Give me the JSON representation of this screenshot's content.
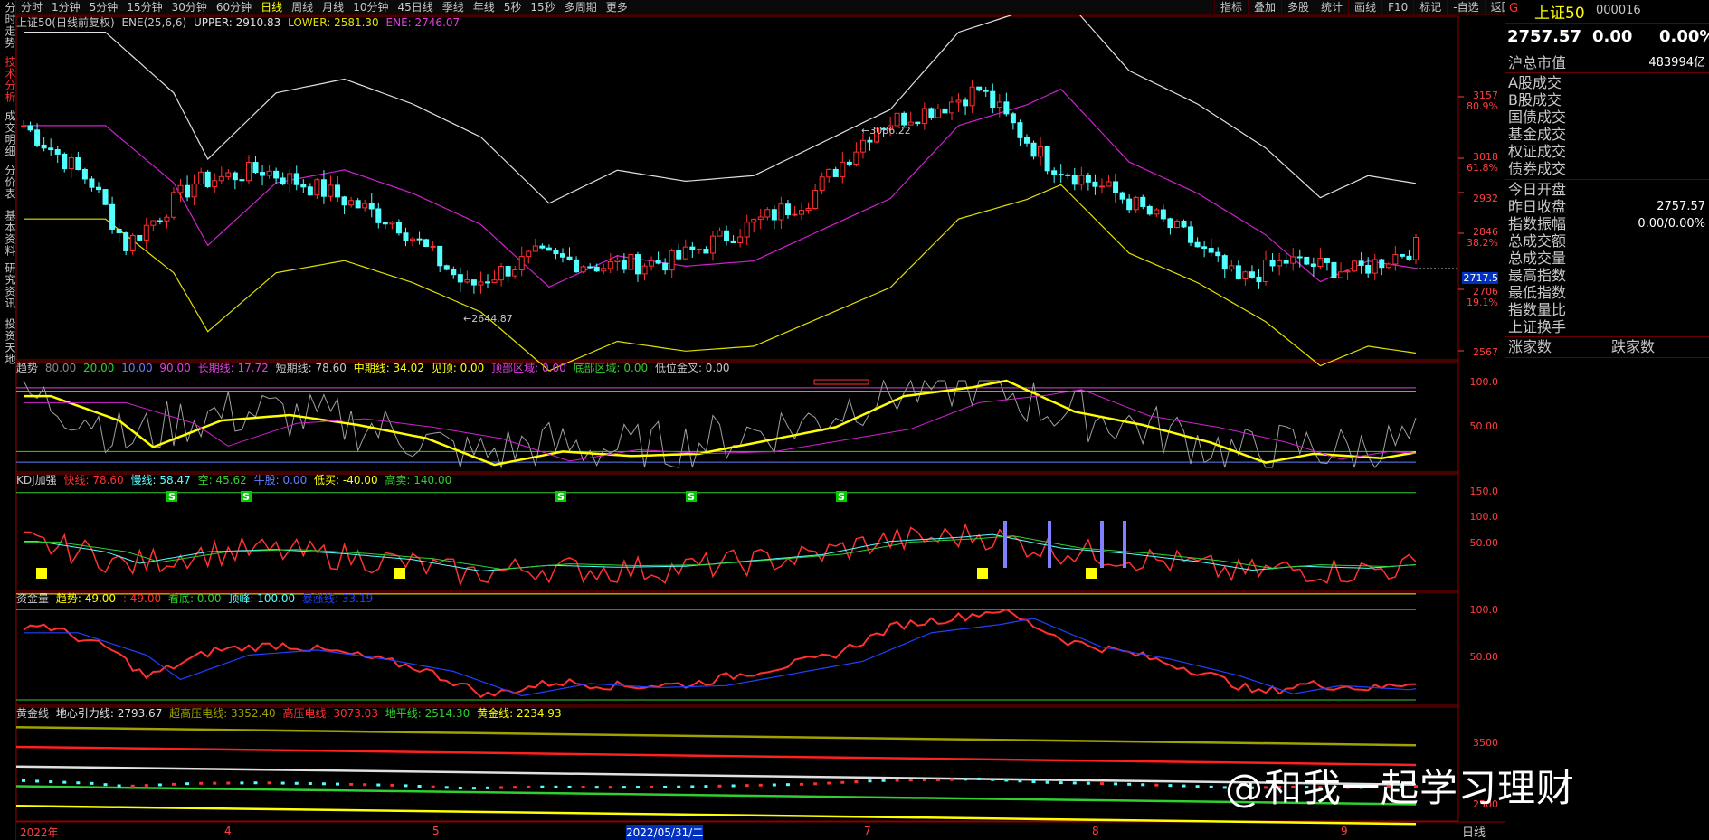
{
  "side_tabs": [
    "分时走势",
    "技术分析",
    "成交明细",
    "分价表",
    "基本资料",
    "研究资讯",
    "投资天地"
  ],
  "timeframes": [
    "分时",
    "1分钟",
    "5分钟",
    "15分钟",
    "30分钟",
    "60分钟",
    "日线",
    "周线",
    "月线",
    "10分钟",
    "45日线",
    "季线",
    "年线",
    "5秒",
    "15秒",
    "多周期",
    "更多"
  ],
  "active_timeframe": "日线",
  "right_tools": [
    "指标",
    "叠加",
    "多股",
    "统计",
    "画线",
    "F10",
    "标记",
    "-自选",
    "返回"
  ],
  "main_panel": {
    "title": "上证50(日线前复权)",
    "ind_name": "ENE(25,6,6)",
    "upper": "UPPER: 2910.83",
    "lower": "LOWER: 2581.30",
    "ene": "ENE: 2746.07",
    "y_labels": [
      "3157",
      "80.9%",
      "3018",
      "61.8%",
      "2932",
      "2846",
      "38.2%",
      "2717.5",
      "2706",
      "19.1%",
      "2567"
    ],
    "high_annot": "3086.22",
    "low_annot": "2644.87"
  },
  "trend_panel": {
    "name": "趋势",
    "v1": "80.00",
    "v2": "20.00",
    "v3": "10.00",
    "v4": "90.00",
    "long_l": "长期线: 17.72",
    "short_l": "短期线: 78.60",
    "mid_l": "中期线: 34.02",
    "top_l": "见顶: 0.00",
    "top_zone": "顶部区域: 0.00",
    "bot_zone": "底部区域: 0.00",
    "gold": "低位金叉: 0.00",
    "y_labels": [
      "100.0",
      "50.00"
    ]
  },
  "kdj_panel": {
    "name": "KDJ加强",
    "fast": "快线: 78.60",
    "slow": "慢线: 58.47",
    "empty": "空: 45.62",
    "bull": "牛股: 0.00",
    "low_buy": "低买: -40.00",
    "high_sell": "高卖: 140.00",
    "y_labels": [
      "150.0",
      "100.0",
      "50.00"
    ],
    "sell_marker": "S"
  },
  "fund_panel": {
    "name": "资金量",
    "trend": "趋势: 49.00",
    "v2": ": 49.00",
    "bottom": "看底: 0.00",
    "top": "顶峰: 100.00",
    "extra": "暴涨线: 33.19",
    "y_labels": [
      "100.0",
      "50.00"
    ]
  },
  "gold_panel": {
    "name": "黄金线",
    "core": "地心引力线: 2793.67",
    "super": "超高压电线: 3352.40",
    "high": "高压电线: 3073.03",
    "ground": "地平线: 2514.30",
    "gold": "黄金线: 2234.93",
    "y_labels": [
      "3500",
      "2500"
    ]
  },
  "dates": [
    "2022年",
    "4",
    "5",
    "2022/05/31/二",
    "7",
    "8",
    "9"
  ],
  "bottom_right": "日线",
  "info": {
    "flag": "G",
    "name": "上证50",
    "code": "000016",
    "price": "2757.57",
    "change": "0.00",
    "pct": "0.00%",
    "mkt_label": "沪总市值",
    "mkt_value": "483994亿",
    "list1": [
      "A股成交",
      "B股成交",
      "国债成交",
      "基金成交",
      "权证成交",
      "债券成交"
    ],
    "list2": [
      [
        "今日开盘",
        ""
      ],
      [
        "昨日收盘",
        "2757.57"
      ],
      [
        "指数振幅",
        "0.00/0.00%"
      ],
      [
        "总成交额",
        ""
      ],
      [
        "总成交量",
        ""
      ],
      [
        "最高指数",
        ""
      ],
      [
        "最低指数",
        ""
      ],
      [
        "指数量比",
        ""
      ],
      [
        "上证换手",
        ""
      ]
    ],
    "up_label": "涨家数",
    "down_label": "跌家数"
  },
  "watermark": "@和我一起学习理财",
  "colors": {
    "up": "#ff3030",
    "down": "#54ffff",
    "upper": "#e0e0e0",
    "mid": "#d020d0",
    "lower": "#e0e000",
    "grid": "#8b0000"
  }
}
